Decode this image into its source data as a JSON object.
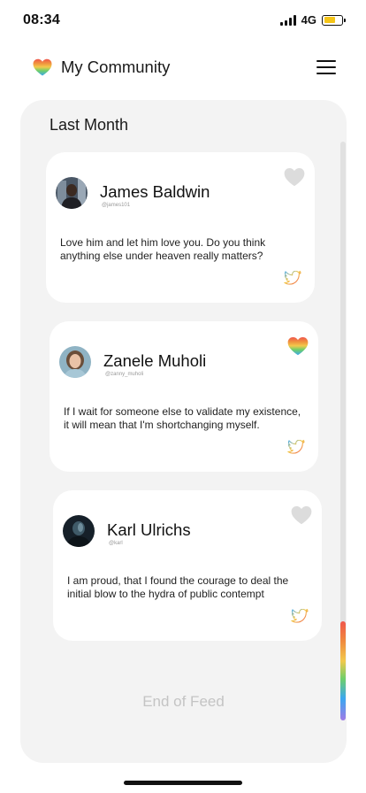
{
  "status_bar": {
    "time": "08:34",
    "network": "4G",
    "battery_color": "#f5c518"
  },
  "header": {
    "title": "My Community",
    "logo_icon": "rainbow-heart-icon",
    "menu_icon": "hamburger-menu-icon"
  },
  "feed": {
    "section_title": "Last Month",
    "posts": [
      {
        "author": "James Baldwin",
        "handle": "@james101",
        "text": "Love him and let him love you. Do you think anything else under heaven really matters?",
        "liked": false,
        "source_icon": "twitter-icon"
      },
      {
        "author": "Zanele Muholi",
        "handle": "@zanny_muholi",
        "text": "If I wait for someone else to validate my existence, it will mean that I'm shortchanging myself.",
        "liked": true,
        "source_icon": "twitter-icon"
      },
      {
        "author": "Karl Ulrichs",
        "handle": "@karl",
        "text": "I am proud, that I found the courage to deal the initial blow to the hydra of public contempt",
        "liked": false,
        "source_icon": "twitter-icon"
      }
    ],
    "end_text": "End of Feed"
  },
  "colors": {
    "like_inactive": "#dcdcdc",
    "twitter_gradient": [
      "#f0564b",
      "#f2c94c",
      "#3ba7f0"
    ]
  }
}
